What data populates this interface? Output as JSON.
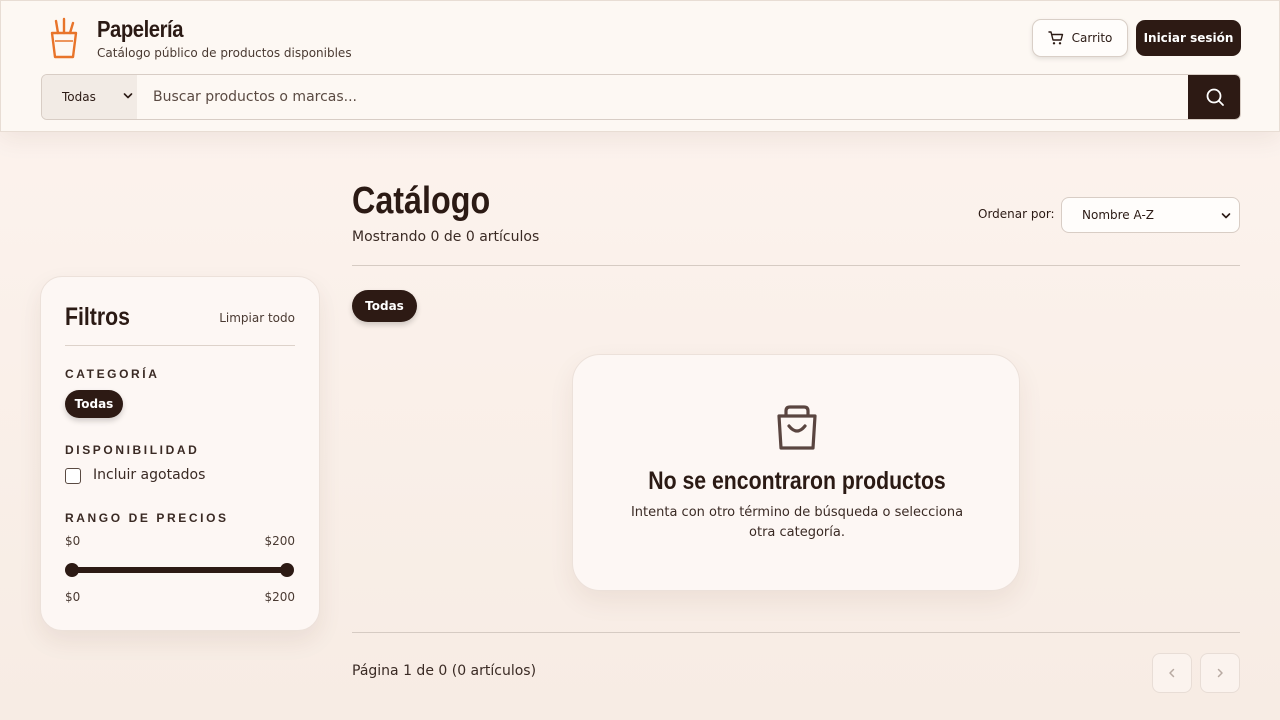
{
  "header": {
    "brand_title": "Papelería",
    "brand_subtitle": "Catálogo público de productos disponibles",
    "cart_label": "Carrito",
    "login_label": "Iniciar sesión"
  },
  "search": {
    "category_selected": "Todas",
    "placeholder": "Buscar productos o marcas..."
  },
  "filters": {
    "title": "Filtros",
    "clear_label": "Limpiar todo",
    "category_heading": "CATEGORÍA",
    "category_chip": "Todas",
    "availability_heading": "DISPONIBILIDAD",
    "include_out_of_stock_label": "Incluir agotados",
    "include_out_of_stock_checked": false,
    "price_heading": "RANGO DE PRECIOS",
    "price_min_label": "$0",
    "price_max_label": "$200",
    "price_selected_min": "$0",
    "price_selected_max": "$200"
  },
  "main": {
    "title": "Catálogo",
    "showing_text": "Mostrando 0 de 0 artículos",
    "sort_label": "Ordenar por:",
    "sort_selected": "Nombre A-Z",
    "category_chip": "Todas",
    "empty_title": "No se encontraron productos",
    "empty_description": "Intenta con otro término de búsqueda o selecciona otra categoría.",
    "pagination_text": "Página 1 de 0 (0 artículos)"
  },
  "icons": {
    "logo": "pencil-cup-icon",
    "cart": "cart-icon",
    "search": "search-icon",
    "empty": "shopping-bag-icon",
    "prev": "chevron-left-icon",
    "next": "chevron-right-icon"
  },
  "colors": {
    "primary": "#2d1a14",
    "accent": "#e8742a",
    "background": "#fdf4ef"
  }
}
